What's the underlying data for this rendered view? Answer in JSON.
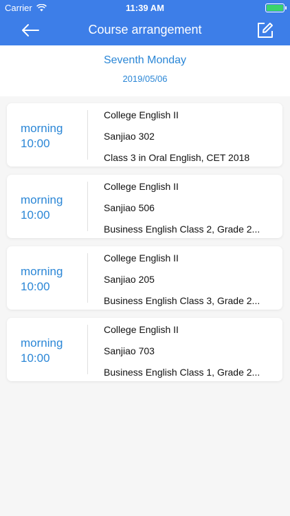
{
  "status_bar": {
    "carrier": "Carrier",
    "time": "11:39 AM",
    "battery_color": "#3bd36b"
  },
  "nav": {
    "title": "Course arrangement",
    "back_icon": "arrow-left-icon",
    "edit_icon": "edit-icon"
  },
  "header": {
    "week": "Seventh Monday",
    "date": "2019/05/06"
  },
  "colors": {
    "primary": "#3d7ee8",
    "accent_text": "#2a86d6"
  },
  "courses": [
    {
      "period": "morning",
      "time": "10:00",
      "course": "College English II",
      "room": "Sanjiao 302",
      "class": "Class 3 in Oral English, CET 2018"
    },
    {
      "period": "morning",
      "time": "10:00",
      "course": "College English II",
      "room": "Sanjiao 506",
      "class": "Business English Class 2, Grade 2..."
    },
    {
      "period": "morning",
      "time": "10:00",
      "course": "College English II",
      "room": "Sanjiao 205",
      "class": "Business English Class 3, Grade 2..."
    },
    {
      "period": "morning",
      "time": "10:00",
      "course": "College English II",
      "room": "Sanjiao 703",
      "class": "Business English Class 1, Grade 2..."
    }
  ]
}
